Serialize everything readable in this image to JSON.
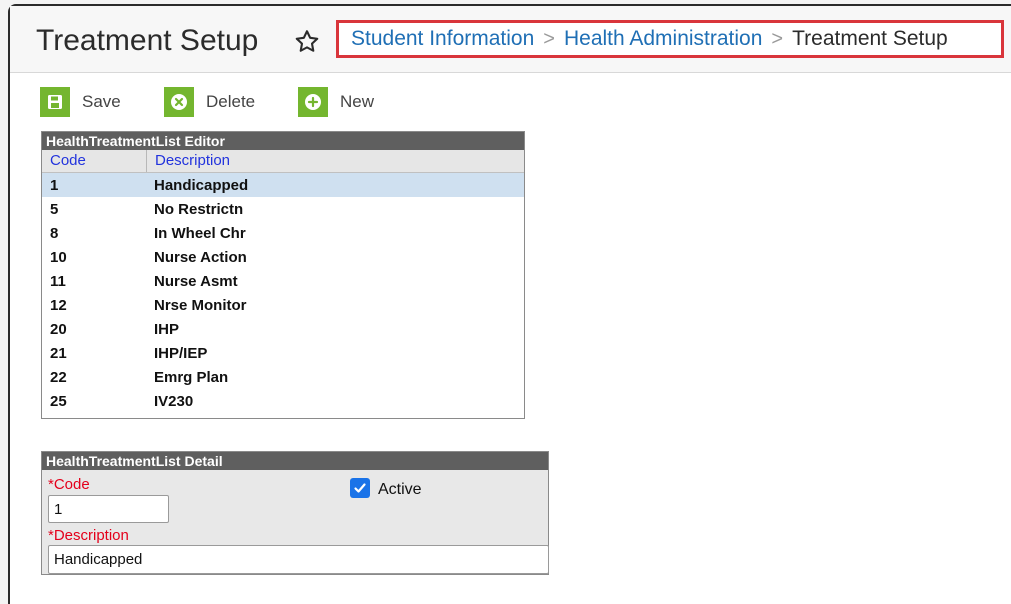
{
  "header": {
    "title": "Treatment Setup",
    "breadcrumb": [
      "Student Information",
      "Health Administration",
      "Treatment Setup"
    ]
  },
  "toolbar": {
    "save_label": "Save",
    "delete_label": "Delete",
    "new_label": "New",
    "icon_color": "#74b62f"
  },
  "list_editor": {
    "title": "HealthTreatmentList Editor",
    "columns": [
      "Code",
      "Description"
    ],
    "selected_index": 0,
    "rows": [
      {
        "code": "1",
        "description": "Handicapped"
      },
      {
        "code": "5",
        "description": "No Restrictn"
      },
      {
        "code": "8",
        "description": "In Wheel Chr"
      },
      {
        "code": "10",
        "description": "Nurse Action"
      },
      {
        "code": "11",
        "description": "Nurse Asmt"
      },
      {
        "code": "12",
        "description": "Nrse Monitor"
      },
      {
        "code": "20",
        "description": "IHP"
      },
      {
        "code": "21",
        "description": "IHP/IEP"
      },
      {
        "code": "22",
        "description": "Emrg Plan"
      },
      {
        "code": "25",
        "description": "IV230"
      }
    ]
  },
  "detail": {
    "title": "HealthTreatmentList Detail",
    "code_label": "*Code",
    "code_value": "1",
    "active_label": "Active",
    "active_checked": true,
    "description_label": "*Description",
    "description_value": "Handicapped"
  },
  "colors": {
    "breadcrumb_highlight": "#d9353b",
    "link": "#1f6fb5",
    "required": "#e4001b",
    "selected_row": "#cfe0f0"
  }
}
